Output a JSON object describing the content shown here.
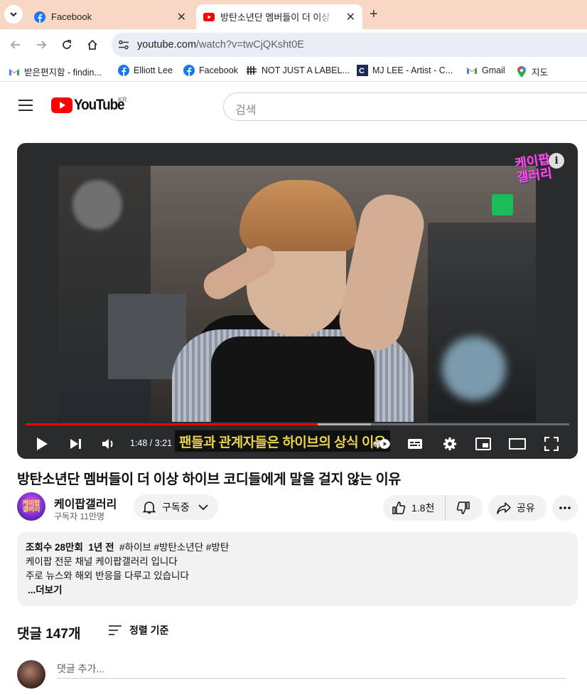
{
  "browser": {
    "tabs": [
      {
        "title": "Facebook",
        "icon": "facebook-icon"
      },
      {
        "title": "방탄소년단 멤버들이 더 이상 하이브",
        "icon": "youtube-icon"
      }
    ],
    "url": {
      "host": "youtube.com",
      "path": "/watch?v=twCjQKsht0E"
    },
    "bookmarks": [
      {
        "label": "받은편지함 - findin...",
        "icon": "gmail-icon"
      },
      {
        "label": "Elliott Lee",
        "icon": "facebook-icon"
      },
      {
        "label": "Facebook",
        "icon": "facebook-icon"
      },
      {
        "label": "NOT JUST A LABEL...",
        "icon": "njal-icon"
      },
      {
        "label": "MJ LEE - Artist - C...",
        "icon": "site-icon"
      },
      {
        "label": "Gmail",
        "icon": "gmail-icon"
      },
      {
        "label": "지도",
        "icon": "maps-icon"
      }
    ]
  },
  "youtube": {
    "logo_text": "YouTube",
    "region": "KR",
    "search_placeholder": "검색"
  },
  "player": {
    "time": "1:48 / 3:21",
    "progress": 0.537,
    "buffered": 0.635,
    "subtitle": "팬들과 관계자들은 하이브의 상식 이유",
    "brand_badge": "케이팝\n갤러리"
  },
  "video": {
    "title": "방탄소년단 멤버들이 더 이상 하이브 코디들에게 말을 걸지 않는 이유",
    "channel": {
      "name": "케이팝갤러리",
      "subscribers": "구독자 11만명",
      "avatar_text": "케이팝\n갤러리"
    },
    "subscribe_label": "구독중",
    "likes": "1.8천",
    "share_label": "공유"
  },
  "description": {
    "views": "조회수 28만회",
    "age": "1년 전",
    "tags": "#하이브 #방탄소년단 #방탄",
    "line1": "케이팝 전문 채널 케이팝갤러리 입니다",
    "line2": "주로 뉴스와 해외 반응을 다루고 있습니다",
    "more": "...더보기"
  },
  "comments": {
    "count_label": "댓글 147개",
    "sort_label": "정렬 기준",
    "input_placeholder": "댓글 추가..."
  }
}
